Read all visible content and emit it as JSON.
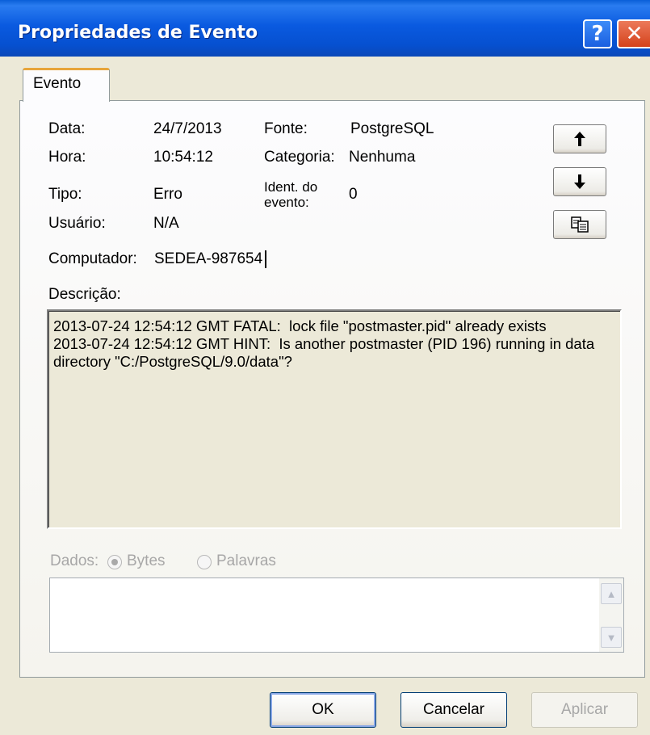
{
  "window": {
    "title": "Propriedades de Evento",
    "help_glyph": "?",
    "close_glyph": "✕"
  },
  "tabs": [
    {
      "label": "Evento",
      "active": true
    }
  ],
  "event": {
    "data_label": "Data:",
    "data_value": "24/7/2013",
    "hora_label": "Hora:",
    "hora_value": "10:54:12",
    "tipo_label": "Tipo:",
    "tipo_value": "Erro",
    "usuario_label": "Usuário:",
    "usuario_value": "N/A",
    "fonte_label": "Fonte:",
    "fonte_value": "PostgreSQL",
    "categoria_label": "Categoria:",
    "categoria_value": "Nenhuma",
    "ident_label": "Ident. do evento:",
    "ident_value": "0",
    "computador_label": "Computador:",
    "computador_value": "SEDEA-987654"
  },
  "nav": {
    "up_icon": "arrow-up-icon",
    "down_icon": "arrow-down-icon",
    "copy_icon": "copy-icon"
  },
  "description": {
    "label": "Descrição:",
    "text": "2013-07-24 12:54:12 GMT FATAL:  lock file \"postmaster.pid\" already exists\n2013-07-24 12:54:12 GMT HINT:  Is another postmaster (PID 196) running in data directory \"C:/PostgreSQL/9.0/data\"?"
  },
  "dados": {
    "label": "Dados:",
    "options": [
      "Bytes",
      "Palavras"
    ],
    "selected": "Bytes",
    "enabled": false
  },
  "buttons": {
    "ok": "OK",
    "cancel": "Cancelar",
    "apply": "Aplicar"
  },
  "colors": {
    "titlebar": "#0a5ae0",
    "tab_accent": "#e7a53b",
    "dialog_bg": "#ece9d8"
  }
}
